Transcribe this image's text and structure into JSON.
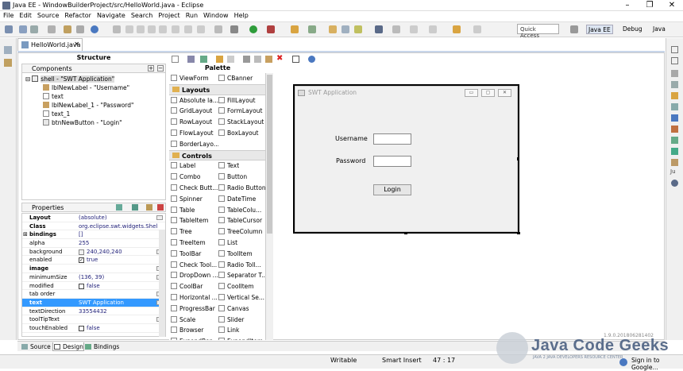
{
  "window": {
    "title": "Java EE - WindowBuilderProject/src/HelloWorld.java - Eclipse"
  },
  "menu": [
    "File",
    "Edit",
    "Source",
    "Refactor",
    "Navigate",
    "Search",
    "Project",
    "Run",
    "Window",
    "Help"
  ],
  "toolbar": {
    "quick_access": "Quick Access",
    "perspectives": [
      "Java EE",
      "Debug",
      "Java"
    ]
  },
  "editor": {
    "tab": "HelloWorld.java"
  },
  "structure": {
    "title": "Structure",
    "components_title": "Components",
    "tree": [
      "shell - \"SWT Application\"",
      "lblNewLabel - \"Username\"",
      "text",
      "lblNewLabel_1 - \"Password\"",
      "text_1",
      "btnNewButton - \"Login\""
    ]
  },
  "properties": {
    "title": "Properties",
    "rows": [
      {
        "name": "Layout",
        "value": "(absolute)"
      },
      {
        "name": "Class",
        "value": "org.eclipse.swt.widgets.Shell"
      },
      {
        "name": "bindings",
        "value": "[]"
      },
      {
        "name": "alpha",
        "value": "255"
      },
      {
        "name": "background",
        "value": "240,240,240"
      },
      {
        "name": "enabled",
        "value": "true"
      },
      {
        "name": "image",
        "value": ""
      },
      {
        "name": "minimumSize",
        "value": "(136, 39)"
      },
      {
        "name": "modified",
        "value": "false"
      },
      {
        "name": "tab order",
        "value": ""
      },
      {
        "name": "text",
        "value": "SWT Application"
      },
      {
        "name": "textDirection",
        "value": "33554432"
      },
      {
        "name": "toolTipText",
        "value": ""
      },
      {
        "name": "touchEnabled",
        "value": "false"
      }
    ]
  },
  "palette": {
    "title": "Palette",
    "top_row": [
      "ViewForm",
      "CBanner"
    ],
    "layouts_label": "Layouts",
    "layouts": [
      [
        "Absolute la...",
        "FillLayout"
      ],
      [
        "GridLayout",
        "FormLayout"
      ],
      [
        "RowLayout",
        "StackLayout"
      ],
      [
        "FlowLayout",
        "BoxLayout"
      ],
      [
        "BorderLayo...",
        ""
      ]
    ],
    "controls_label": "Controls",
    "controls": [
      [
        "Label",
        "Text"
      ],
      [
        "Combo",
        "Button"
      ],
      [
        "Check Butt...",
        "Radio Button"
      ],
      [
        "Spinner",
        "DateTime"
      ],
      [
        "Table",
        "TableColu..."
      ],
      [
        "TableItem",
        "TableCursor"
      ],
      [
        "Tree",
        "TreeColumn"
      ],
      [
        "TreeItem",
        "List"
      ],
      [
        "ToolBar",
        "ToolItem"
      ],
      [
        "Check Tool...",
        "Radio Toll..."
      ],
      [
        "DropDown ...",
        "Separator T..."
      ],
      [
        "CoolBar",
        "CoolItem"
      ],
      [
        "Horizontal ...",
        "Vertical Se..."
      ],
      [
        "ProgressBar",
        "Canvas"
      ],
      [
        "Scale",
        "Slider"
      ],
      [
        "Browser",
        "Link"
      ],
      [
        "ExpandBar",
        "ExpandItem"
      ]
    ]
  },
  "swt_window": {
    "title": "SWT Application",
    "username_label": "Username",
    "password_label": "Password",
    "login_button": "Login"
  },
  "bottom_tabs": [
    "Source",
    "Design",
    "Bindings"
  ],
  "status": {
    "writable": "Writable",
    "insert_mode": "Smart Insert",
    "position": "47 : 17"
  },
  "watermark": {
    "brand": "Java Code Geeks",
    "tagline": "JAVA 2 JAVA DEVELOPERS RESOURCE CENTER",
    "version": "1.9.0.201806281402"
  },
  "status_right": "Sign in to Google..."
}
